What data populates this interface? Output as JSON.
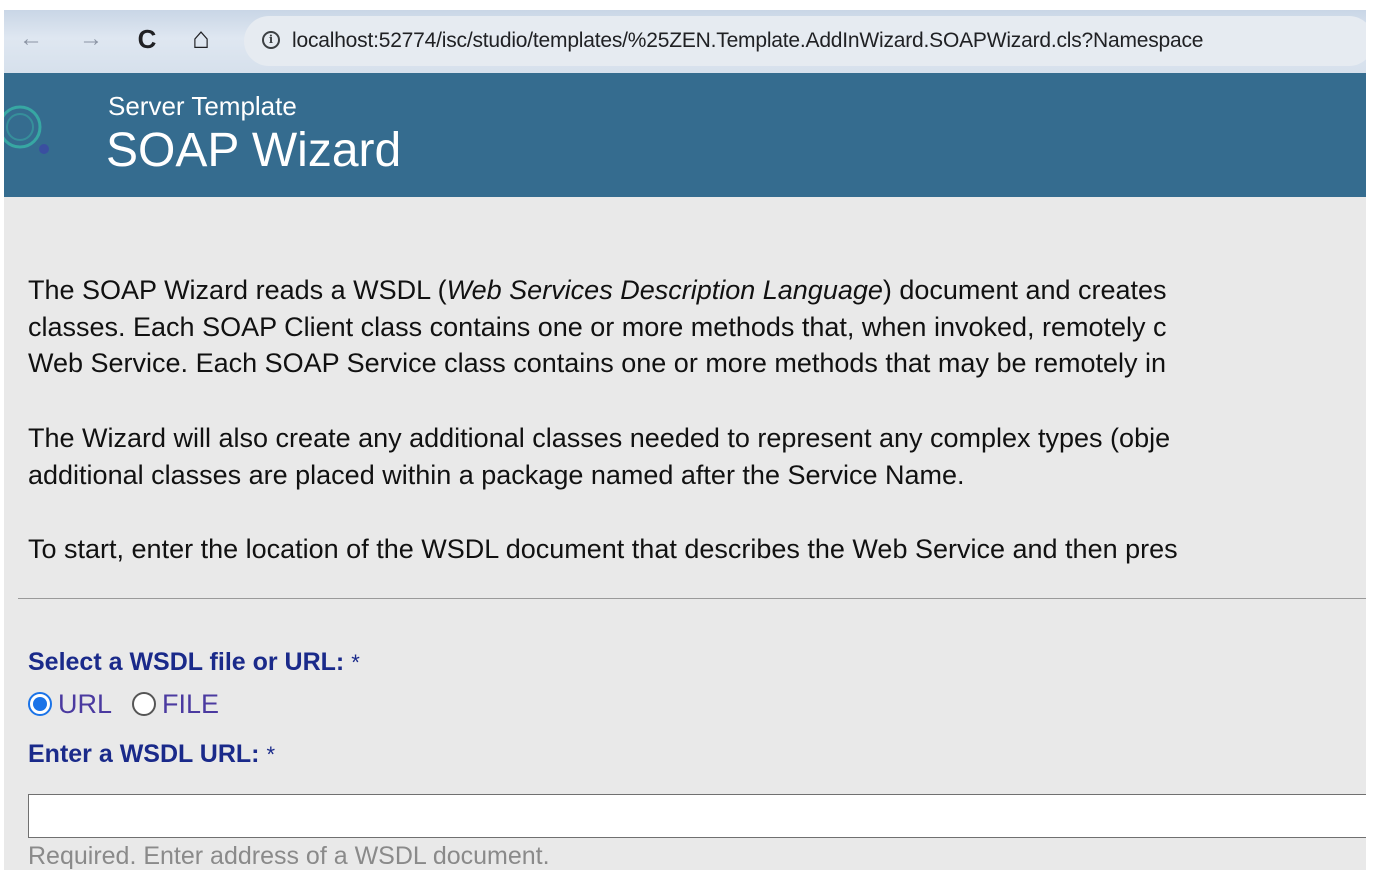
{
  "browser": {
    "url": "localhost:52774/isc/studio/templates/%25ZEN.Template.AddInWizard.SOAPWizard.cls?Namespace",
    "buttons": {
      "back": "←",
      "forward": "→",
      "reload": "C",
      "home": "⌂",
      "info": "i"
    }
  },
  "header": {
    "subtitle": "Server Template",
    "title": "SOAP Wizard",
    "color": "#356c8f"
  },
  "intro": {
    "p1_l1_a": "The SOAP Wizard reads a WSDL (",
    "p1_l1_em": "Web Services Description Language",
    "p1_l1_b": ") document and creates",
    "p1_l2": "classes. Each SOAP Client class contains one or more methods that, when invoked, remotely c",
    "p1_l3": "Web Service. Each SOAP Service class contains one or more methods that may be remotely in",
    "p2_l1": "The Wizard will also create any additional classes needed to represent any complex types (obje",
    "p2_l2": "additional classes are placed within a package named after the Service Name.",
    "p3_l1": "To start, enter the location of the WSDL document that describes the Web Service and then pres"
  },
  "form": {
    "select_label": "Select a WSDL file or URL:",
    "required_mark": "*",
    "options": [
      {
        "label": "URL",
        "selected": true
      },
      {
        "label": "FILE",
        "selected": false
      }
    ],
    "url_label": "Enter a WSDL URL:",
    "url_value": "",
    "url_hint": "Required. Enter address of a WSDL document."
  }
}
